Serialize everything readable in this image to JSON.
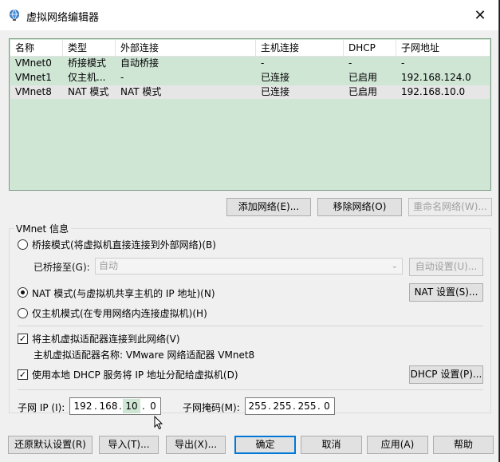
{
  "window": {
    "title": "虚拟网络编辑器",
    "close_glyph": "✕"
  },
  "table": {
    "columns": [
      "名称",
      "类型",
      "外部连接",
      "主机连接",
      "DHCP",
      "子网地址"
    ],
    "rows": [
      [
        "VMnet0",
        "桥接模式",
        "自动桥接",
        "-",
        "-",
        "-"
      ],
      [
        "VMnet1",
        "仅主机...",
        "-",
        "已连接",
        "已启用",
        "192.168.124.0"
      ],
      [
        "VMnet8",
        "NAT 模式",
        "NAT 模式",
        "已连接",
        "已启用",
        "192.168.10.0"
      ]
    ],
    "selected_row": 2
  },
  "list_buttons": {
    "add": "添加网络(E)...",
    "remove": "移除网络(O)",
    "rename": "重命名网络(W)..."
  },
  "vmnet_info": {
    "title": "VMnet 信息",
    "bridged_label": "桥接模式(将虚拟机直接连接到外部网络)(B)",
    "bridged_to_label": "已桥接至(G):",
    "bridged_to_value": "自动",
    "auto_settings": "自动设置(U)...",
    "nat_label": "NAT 模式(与虚拟机共享主机的 IP 地址)(N)",
    "nat_settings": "NAT 设置(S)...",
    "hostonly_label": "仅主机模式(在专用网络内连接虚拟机)(H)",
    "connect_adapter_label": "将主机虚拟适配器连接到此网络(V)",
    "adapter_name_label": "主机虚拟适配器名称: VMware 网络适配器 VMnet8",
    "dhcp_label": "使用本地 DHCP 服务将 IP 地址分配给虚拟机(D)",
    "dhcp_settings": "DHCP 设置(P)...",
    "mode": "nat",
    "connect_adapter_checked": true,
    "dhcp_checked": true
  },
  "subnet": {
    "ip_label": "子网 IP (I):",
    "ip": [
      "192",
      "168",
      "10",
      "0"
    ],
    "mask_label": "子网掩码(M):",
    "mask": [
      "255",
      "255",
      "255",
      "0"
    ]
  },
  "footer": {
    "restore": "还原默认设置(R)",
    "import": "导入(T)...",
    "export": "导出(X)...",
    "ok": "确定",
    "cancel": "取消",
    "apply": "应用(A)",
    "help": "帮助"
  },
  "colors": {
    "list_bg": "#cfe6d5",
    "selected_row": "#e6e6e6",
    "accent": "#0078d7"
  },
  "icons": {
    "title": "network-globe-icon",
    "check": "checkmark-icon",
    "cursor": "mouse-cursor-icon"
  }
}
